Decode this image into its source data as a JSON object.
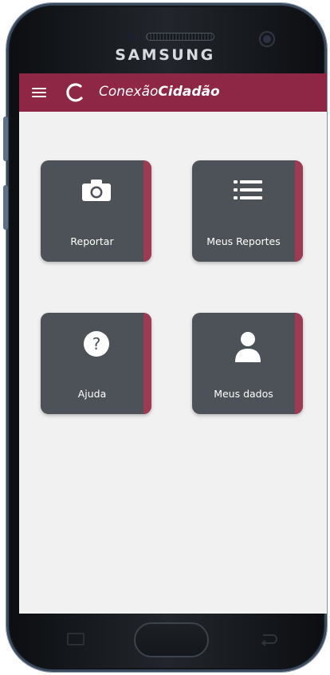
{
  "device": {
    "brand": "SAMSUNG"
  },
  "appbar": {
    "title_light": "Conexão",
    "title_bold": "Cidadão",
    "color": "#8e2645",
    "menu_icon": "hamburger-menu-icon",
    "logo_icon": "circular-arrow-logo-icon"
  },
  "tiles": [
    {
      "label": "Reportar",
      "icon": "camera-icon"
    },
    {
      "label": "Meus Reportes",
      "icon": "list-icon"
    },
    {
      "label": "Ajuda",
      "icon": "help-question-icon"
    },
    {
      "label": "Meus dados",
      "icon": "person-icon"
    }
  ],
  "colors": {
    "tile_bg": "#4c5257",
    "tile_accent": "#9e3a52",
    "screen_bg": "#f1f1f1"
  }
}
